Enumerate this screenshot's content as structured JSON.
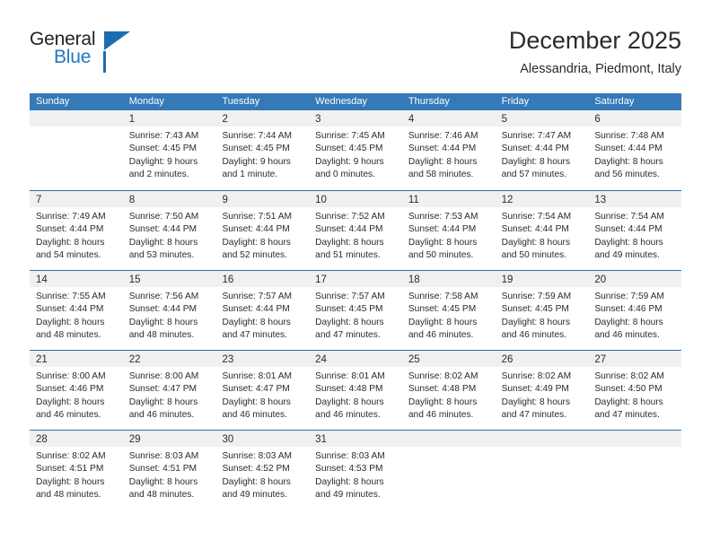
{
  "logo": {
    "word1": "General",
    "word2": "Blue",
    "accent_color": "#1b6cb0"
  },
  "header": {
    "title": "December 2025",
    "subtitle": "Alessandria, Piedmont, Italy"
  },
  "theme": {
    "header_band": "#3479b8",
    "week_divider": "#2f6fab",
    "daynum_band": "#f0f0f0",
    "text": "#2b2b2b"
  },
  "weekdays": [
    "Sunday",
    "Monday",
    "Tuesday",
    "Wednesday",
    "Thursday",
    "Friday",
    "Saturday"
  ],
  "weeks": [
    [
      {
        "day": "",
        "lines": []
      },
      {
        "day": "1",
        "lines": [
          "Sunrise: 7:43 AM",
          "Sunset: 4:45 PM",
          "Daylight: 9 hours",
          "and 2 minutes."
        ]
      },
      {
        "day": "2",
        "lines": [
          "Sunrise: 7:44 AM",
          "Sunset: 4:45 PM",
          "Daylight: 9 hours",
          "and 1 minute."
        ]
      },
      {
        "day": "3",
        "lines": [
          "Sunrise: 7:45 AM",
          "Sunset: 4:45 PM",
          "Daylight: 9 hours",
          "and 0 minutes."
        ]
      },
      {
        "day": "4",
        "lines": [
          "Sunrise: 7:46 AM",
          "Sunset: 4:44 PM",
          "Daylight: 8 hours",
          "and 58 minutes."
        ]
      },
      {
        "day": "5",
        "lines": [
          "Sunrise: 7:47 AM",
          "Sunset: 4:44 PM",
          "Daylight: 8 hours",
          "and 57 minutes."
        ]
      },
      {
        "day": "6",
        "lines": [
          "Sunrise: 7:48 AM",
          "Sunset: 4:44 PM",
          "Daylight: 8 hours",
          "and 56 minutes."
        ]
      }
    ],
    [
      {
        "day": "7",
        "lines": [
          "Sunrise: 7:49 AM",
          "Sunset: 4:44 PM",
          "Daylight: 8 hours",
          "and 54 minutes."
        ]
      },
      {
        "day": "8",
        "lines": [
          "Sunrise: 7:50 AM",
          "Sunset: 4:44 PM",
          "Daylight: 8 hours",
          "and 53 minutes."
        ]
      },
      {
        "day": "9",
        "lines": [
          "Sunrise: 7:51 AM",
          "Sunset: 4:44 PM",
          "Daylight: 8 hours",
          "and 52 minutes."
        ]
      },
      {
        "day": "10",
        "lines": [
          "Sunrise: 7:52 AM",
          "Sunset: 4:44 PM",
          "Daylight: 8 hours",
          "and 51 minutes."
        ]
      },
      {
        "day": "11",
        "lines": [
          "Sunrise: 7:53 AM",
          "Sunset: 4:44 PM",
          "Daylight: 8 hours",
          "and 50 minutes."
        ]
      },
      {
        "day": "12",
        "lines": [
          "Sunrise: 7:54 AM",
          "Sunset: 4:44 PM",
          "Daylight: 8 hours",
          "and 50 minutes."
        ]
      },
      {
        "day": "13",
        "lines": [
          "Sunrise: 7:54 AM",
          "Sunset: 4:44 PM",
          "Daylight: 8 hours",
          "and 49 minutes."
        ]
      }
    ],
    [
      {
        "day": "14",
        "lines": [
          "Sunrise: 7:55 AM",
          "Sunset: 4:44 PM",
          "Daylight: 8 hours",
          "and 48 minutes."
        ]
      },
      {
        "day": "15",
        "lines": [
          "Sunrise: 7:56 AM",
          "Sunset: 4:44 PM",
          "Daylight: 8 hours",
          "and 48 minutes."
        ]
      },
      {
        "day": "16",
        "lines": [
          "Sunrise: 7:57 AM",
          "Sunset: 4:44 PM",
          "Daylight: 8 hours",
          "and 47 minutes."
        ]
      },
      {
        "day": "17",
        "lines": [
          "Sunrise: 7:57 AM",
          "Sunset: 4:45 PM",
          "Daylight: 8 hours",
          "and 47 minutes."
        ]
      },
      {
        "day": "18",
        "lines": [
          "Sunrise: 7:58 AM",
          "Sunset: 4:45 PM",
          "Daylight: 8 hours",
          "and 46 minutes."
        ]
      },
      {
        "day": "19",
        "lines": [
          "Sunrise: 7:59 AM",
          "Sunset: 4:45 PM",
          "Daylight: 8 hours",
          "and 46 minutes."
        ]
      },
      {
        "day": "20",
        "lines": [
          "Sunrise: 7:59 AM",
          "Sunset: 4:46 PM",
          "Daylight: 8 hours",
          "and 46 minutes."
        ]
      }
    ],
    [
      {
        "day": "21",
        "lines": [
          "Sunrise: 8:00 AM",
          "Sunset: 4:46 PM",
          "Daylight: 8 hours",
          "and 46 minutes."
        ]
      },
      {
        "day": "22",
        "lines": [
          "Sunrise: 8:00 AM",
          "Sunset: 4:47 PM",
          "Daylight: 8 hours",
          "and 46 minutes."
        ]
      },
      {
        "day": "23",
        "lines": [
          "Sunrise: 8:01 AM",
          "Sunset: 4:47 PM",
          "Daylight: 8 hours",
          "and 46 minutes."
        ]
      },
      {
        "day": "24",
        "lines": [
          "Sunrise: 8:01 AM",
          "Sunset: 4:48 PM",
          "Daylight: 8 hours",
          "and 46 minutes."
        ]
      },
      {
        "day": "25",
        "lines": [
          "Sunrise: 8:02 AM",
          "Sunset: 4:48 PM",
          "Daylight: 8 hours",
          "and 46 minutes."
        ]
      },
      {
        "day": "26",
        "lines": [
          "Sunrise: 8:02 AM",
          "Sunset: 4:49 PM",
          "Daylight: 8 hours",
          "and 47 minutes."
        ]
      },
      {
        "day": "27",
        "lines": [
          "Sunrise: 8:02 AM",
          "Sunset: 4:50 PM",
          "Daylight: 8 hours",
          "and 47 minutes."
        ]
      }
    ],
    [
      {
        "day": "28",
        "lines": [
          "Sunrise: 8:02 AM",
          "Sunset: 4:51 PM",
          "Daylight: 8 hours",
          "and 48 minutes."
        ]
      },
      {
        "day": "29",
        "lines": [
          "Sunrise: 8:03 AM",
          "Sunset: 4:51 PM",
          "Daylight: 8 hours",
          "and 48 minutes."
        ]
      },
      {
        "day": "30",
        "lines": [
          "Sunrise: 8:03 AM",
          "Sunset: 4:52 PM",
          "Daylight: 8 hours",
          "and 49 minutes."
        ]
      },
      {
        "day": "31",
        "lines": [
          "Sunrise: 8:03 AM",
          "Sunset: 4:53 PM",
          "Daylight: 8 hours",
          "and 49 minutes."
        ]
      },
      {
        "day": "",
        "lines": []
      },
      {
        "day": "",
        "lines": []
      },
      {
        "day": "",
        "lines": []
      }
    ]
  ]
}
